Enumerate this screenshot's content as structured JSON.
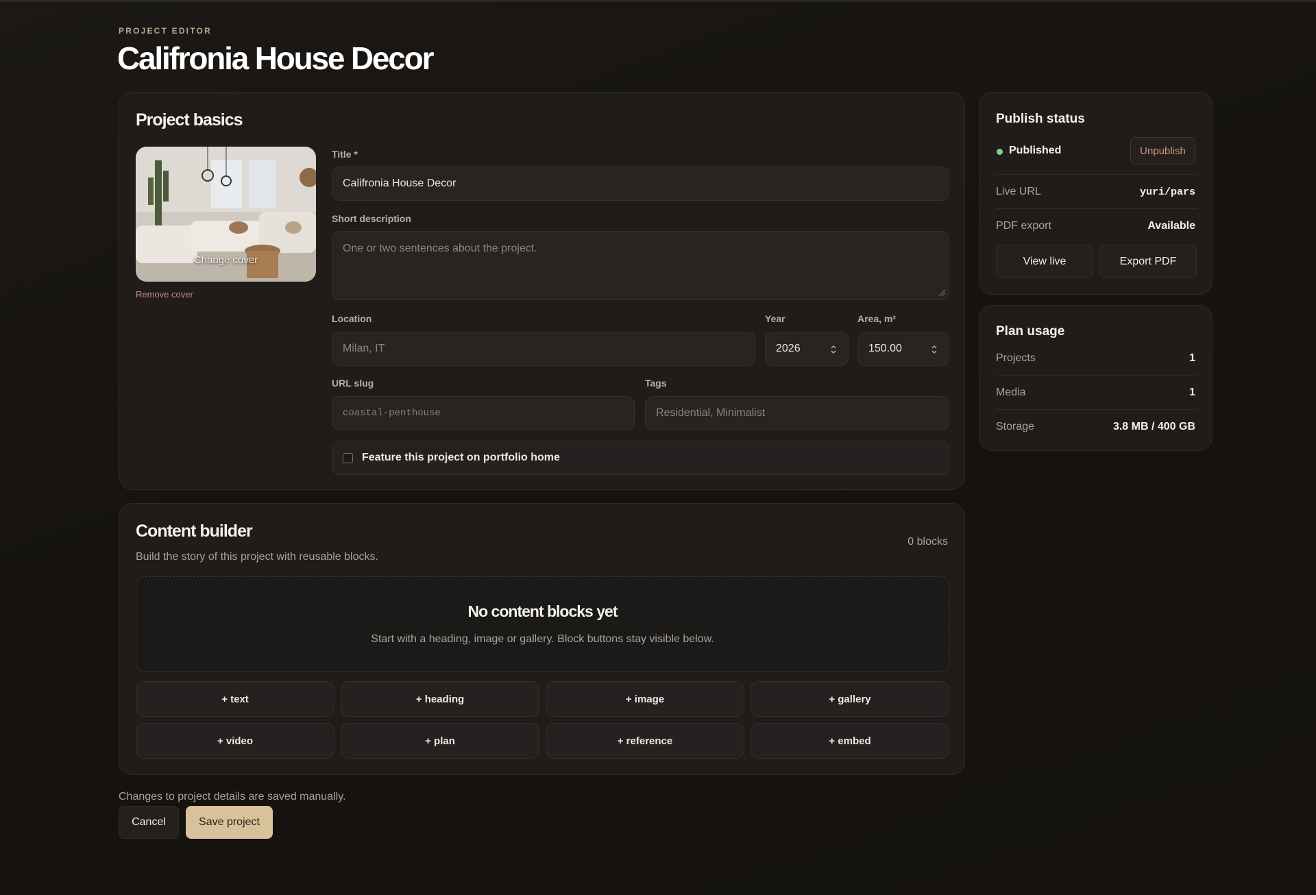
{
  "header": {
    "eyebrow": "PROJECT EDITOR",
    "title": "Califronia House Decor"
  },
  "basics": {
    "heading": "Project basics",
    "cover_label": "Change cover",
    "remove_cover": "Remove cover",
    "title_label": "Title *",
    "title_value": "Califronia House Decor",
    "description_label": "Short description",
    "description_placeholder": "One or two sentences about the project.",
    "location_label": "Location",
    "location_placeholder": "Milan, IT",
    "year_label": "Year",
    "year_value": "2026",
    "area_label": "Area, m²",
    "area_value": "150.00",
    "slug_label": "URL slug",
    "slug_placeholder": "coastal-penthouse",
    "tags_label": "Tags",
    "tags_placeholder": "Residential, Minimalist",
    "feature_label": "Feature this project on portfolio home"
  },
  "builder": {
    "heading": "Content builder",
    "subtitle": "Build the story of this project with reusable blocks.",
    "count": "0 blocks",
    "empty_title": "No content blocks yet",
    "empty_subtitle": "Start with a heading, image or gallery. Block buttons stay visible below.",
    "blocks": [
      "+ text",
      "+ heading",
      "+ image",
      "+ gallery",
      "+ video",
      "+ plan",
      "+ reference",
      "+ embed"
    ]
  },
  "footer": {
    "note": "Changes to project details are saved manually.",
    "cancel": "Cancel",
    "save": "Save project"
  },
  "publish": {
    "heading": "Publish status",
    "status": "Published",
    "unpublish": "Unpublish",
    "live_url_label": "Live URL",
    "live_url_value": "yuri/pars",
    "pdf_label": "PDF export",
    "pdf_value": "Available",
    "view_live": "View live",
    "export_pdf": "Export PDF"
  },
  "plan": {
    "heading": "Plan usage",
    "projects_label": "Projects",
    "projects_value": "1",
    "media_label": "Media",
    "media_value": "1",
    "storage_label": "Storage",
    "storage_value": "3.8 MB / 400 GB"
  },
  "colors": {
    "accent": "#d8c29c",
    "status_green": "#7fd18f",
    "danger": "#d69488"
  }
}
